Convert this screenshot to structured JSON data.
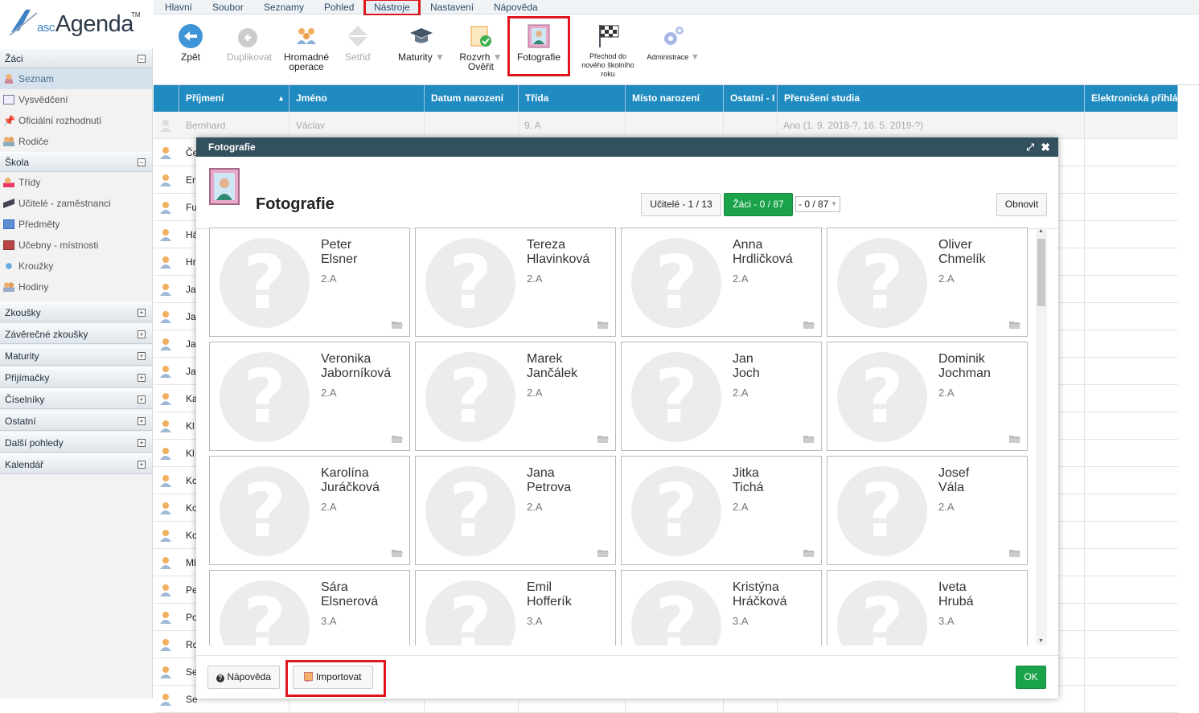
{
  "app": {
    "logo_prefix": "asc",
    "logo_text": "Agenda",
    "tm": "TM"
  },
  "menu": [
    "Hlavní",
    "Soubor",
    "Seznamy",
    "Pohled",
    "Nástroje",
    "Nastavení",
    "Nápověda"
  ],
  "toolbar": {
    "back": "Zpět",
    "duplicate": "Duplikovat",
    "bulk_line1": "Hromadné",
    "bulk_line2": "operace",
    "sort": "Setřiď",
    "maturity": "Maturity",
    "rozvrh_line1": "Rozvrh",
    "rozvrh_line2": "Ověřit",
    "photos": "Fotografie",
    "transition_line1": "Přechod do",
    "transition_line2": "nového školního",
    "transition_line3": "roku",
    "admin": "Administrace"
  },
  "sidebar": {
    "sections": [
      {
        "label": "Žáci",
        "items": [
          "Seznam",
          "Vysvědčení",
          "Oficiální rozhodnutí",
          "Rodiče"
        ]
      },
      {
        "label": "Škola",
        "items": [
          "Třídy",
          "Učitelé - zaměstnanci",
          "Předměty",
          "Učebny - místnosti",
          "Kroužky",
          "Hodiny"
        ]
      }
    ],
    "collapsed": [
      "Zkoušky",
      "Závěrečné zkoušky",
      "Maturity",
      "Přijímačky",
      "Číselníky",
      "Ostatní",
      "Další pohledy",
      "Kalendář"
    ]
  },
  "grid": {
    "columns": [
      "Příjmení",
      "Jméno",
      "Datum narození",
      "Třída",
      "Místo narození",
      "Ostatní - I",
      "Přerušení studia",
      "Elektronická přihlá"
    ],
    "first_row": {
      "surname": "Bernhard",
      "name": "Václav",
      "class": "9. A",
      "interruption": "Ano (1. 9. 2018-?, 16. 5. 2019-?)"
    },
    "row_prefixes": [
      "Če",
      "Er",
      "Fu",
      "Há",
      "Hr",
      "Ja",
      "Ja",
      "Ja",
      "Ja",
      "Ka",
      "Kl",
      "Kl",
      "Ko",
      "Ko",
      "Ko",
      "Ml",
      "Pe",
      "Po",
      "Ro",
      "Se",
      "Se"
    ]
  },
  "dialog": {
    "title": "Fotografie",
    "heading": "Fotografie",
    "teachers_btn": "Učitelé - 1 / 13",
    "students_btn": "Žáci - 0 / 87",
    "select_value": "- 0 / 87",
    "refresh": "Obnovit",
    "help": "Nápověda",
    "import": "Importovat",
    "ok": "OK",
    "cards": [
      {
        "first": "Peter",
        "last": "Elsner",
        "cls": "2.A"
      },
      {
        "first": "Tereza",
        "last": "Hlavinková",
        "cls": "2.A"
      },
      {
        "first": "Anna",
        "last": "Hrdličková",
        "cls": "2.A"
      },
      {
        "first": "Oliver",
        "last": "Chmelík",
        "cls": "2.A"
      },
      {
        "first": "Veronika",
        "last": "Jaborníková",
        "cls": "2.A"
      },
      {
        "first": "Marek",
        "last": "Jančálek",
        "cls": "2.A"
      },
      {
        "first": "Jan",
        "last": "Joch",
        "cls": "2.A"
      },
      {
        "first": "Dominik",
        "last": "Jochman",
        "cls": "2.A"
      },
      {
        "first": "Karolína",
        "last": "Juráčková",
        "cls": "2.A"
      },
      {
        "first": "Jana",
        "last": "Petrova",
        "cls": "2.A"
      },
      {
        "first": "Jitka",
        "last": "Tichá",
        "cls": "2.A"
      },
      {
        "first": "Josef",
        "last": "Vála",
        "cls": "2.A"
      },
      {
        "first": "Sára",
        "last": "Elsnerová",
        "cls": "3.A"
      },
      {
        "first": "Emil",
        "last": "Hofferík",
        "cls": "3.A"
      },
      {
        "first": "Kristýna",
        "last": "Hráčková",
        "cls": "3.A"
      },
      {
        "first": "Iveta",
        "last": "Hrubá",
        "cls": "3.A"
      }
    ]
  },
  "colors": {
    "header_blue": "#1f8bc0",
    "dialog_title": "#33505f",
    "green": "#1aa34a",
    "highlight": "#e0161e"
  }
}
